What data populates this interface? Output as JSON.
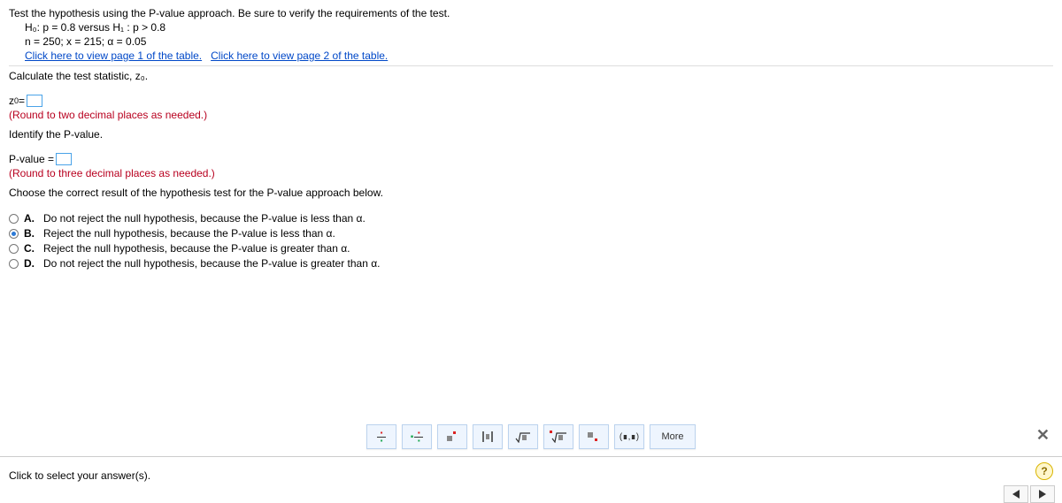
{
  "question": {
    "intro": "Test the hypothesis using the P-value approach. Be sure to verify the requirements of the test.",
    "hypothesis": "H₀: p = 0.8 versus H₁ : p > 0.8",
    "params": "n = 250; x = 215; α = 0.05",
    "link1": "Click here to view page 1 of the table.",
    "link2": "Click here to view page 2 of the table.",
    "calc_prompt": "Calculate the test statistic, z₀.",
    "z0_label_pre": "z",
    "z0_label_sub": "0",
    "z0_label_post": " = ",
    "z0_round": "(Round to two decimal places as needed.)",
    "pvalue_prompt": "Identify the P-value.",
    "pvalue_label": "P-value = ",
    "pvalue_round": "(Round to three decimal places as needed.)",
    "choose_prompt": "Choose the correct result of the hypothesis test for the P-value approach below."
  },
  "options": {
    "A": "Do not reject the null hypothesis, because the P-value is less than α.",
    "B": "Reject the null hypothesis, because the P-value is less than α.",
    "C": "Reject the null hypothesis, because the P-value is greater than α.",
    "D": "Do not reject the null hypothesis, because the P-value is greater than α."
  },
  "toolbar": {
    "more": "More",
    "interval": "(∎,∎)"
  },
  "footer": {
    "prompt": "Click to select your answer(s)."
  }
}
